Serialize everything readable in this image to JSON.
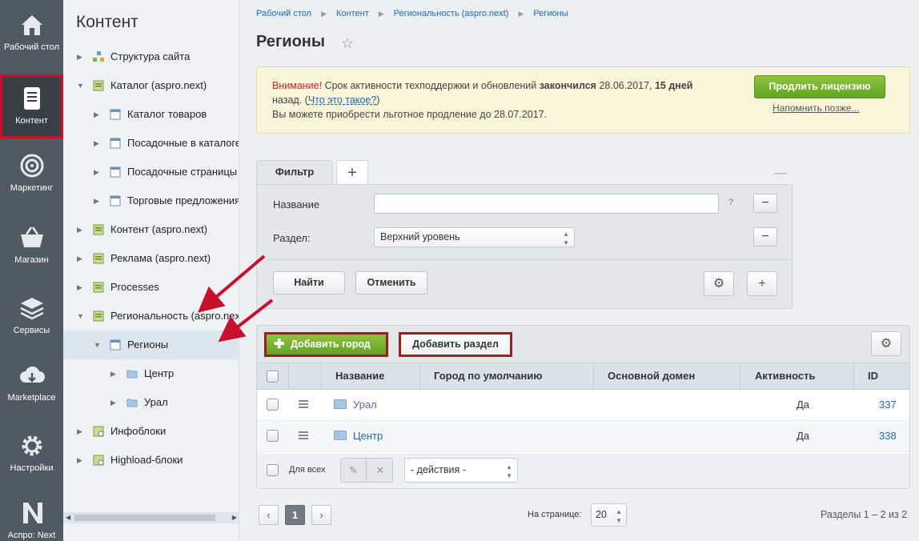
{
  "rail": {
    "items": [
      {
        "label": "Рабочий стол",
        "icon": "home-icon"
      },
      {
        "label": "Контент",
        "icon": "document-icon"
      },
      {
        "label": "Маркетинг",
        "icon": "target-icon"
      },
      {
        "label": "Магазин",
        "icon": "basket-icon"
      },
      {
        "label": "Сервисы",
        "icon": "layers-icon"
      },
      {
        "label": "Marketplace",
        "icon": "cloud-download-icon"
      },
      {
        "label": "Настройки",
        "icon": "gear-icon"
      },
      {
        "label": "Аспро: Next",
        "icon": "aspro-logo-icon"
      }
    ],
    "active_index": 1
  },
  "tree": {
    "title": "Контент",
    "items": [
      {
        "label": "Структура сайта"
      },
      {
        "label": "Каталог (aspro.next)"
      },
      {
        "label": "Каталог товаров"
      },
      {
        "label": "Посадочные в каталоге"
      },
      {
        "label": "Посадочные страницы"
      },
      {
        "label": "Торговые предложения"
      },
      {
        "label": "Контент (aspro.next)"
      },
      {
        "label": "Реклама (aspro.next)"
      },
      {
        "label": "Processes"
      },
      {
        "label": "Региональность (aspro.next)"
      },
      {
        "label": "Регионы"
      },
      {
        "label": "Центр"
      },
      {
        "label": "Урал"
      },
      {
        "label": "Инфоблоки"
      },
      {
        "label": "Highload-блоки"
      }
    ]
  },
  "breadcrumb": [
    "Рабочий стол",
    "Контент",
    "Региональность (aspro.next)",
    "Регионы"
  ],
  "page_title": "Регионы",
  "notice": {
    "warning_label": "Внимание!",
    "text1": " Срок активности техподдержки и обновлений ",
    "expired": "закончился",
    "date1": " 28.06.2017, ",
    "days": "15 дней",
    "text2": "назад. (",
    "link": "Что это такое?",
    "text3": ")",
    "text4": "Вы можете приобрести льготное продление до 28.07.2017.",
    "button": "Продлить лицензию",
    "remind": "Напомнить позже..."
  },
  "filter": {
    "tab_label": "Фильтр",
    "add_tab": "+",
    "collapse": "—",
    "name_label": "Название",
    "name_value": "",
    "help": "?",
    "section_label": "Раздел:",
    "section_value": "Верхний уровень",
    "find_button": "Найти",
    "cancel_button": "Отменить"
  },
  "actions": {
    "add_city": "Добавить город",
    "add_section": "Добавить раздел"
  },
  "grid": {
    "columns": [
      "Название",
      "Город по умолчанию",
      "Основной домен",
      "Активность",
      "ID"
    ],
    "rows": [
      {
        "name": "Урал",
        "default_city": "",
        "domain": "",
        "active": "Да",
        "id": "337"
      },
      {
        "name": "Центр",
        "default_city": "",
        "domain": "",
        "active": "Да",
        "id": "338"
      }
    ],
    "for_all": "Для всех",
    "actions_select": "- действия -"
  },
  "pager": {
    "current_page": "1",
    "per_page_label": "На странице:",
    "per_page": "20",
    "counts": "Разделы 1 – 2 из 2"
  },
  "colors": {
    "rail_bg": "#515a63",
    "accent_green": "#6fae2a",
    "highlight_red": "#a31a25"
  }
}
